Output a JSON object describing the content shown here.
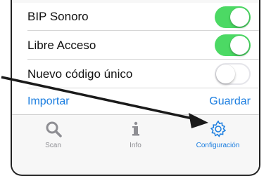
{
  "settings": {
    "rows": [
      {
        "label": "BIP Sonoro",
        "on": true
      },
      {
        "label": "Libre Acceso",
        "on": true
      },
      {
        "label": "Nuevo código único",
        "on": false
      }
    ],
    "import_label": "Importar",
    "save_label": "Guardar"
  },
  "tabbar": {
    "tabs": [
      {
        "label": "Scan",
        "icon": "search-icon",
        "active": false
      },
      {
        "label": "Info",
        "icon": "info-icon",
        "active": false
      },
      {
        "label": "Configuración",
        "icon": "gear-icon",
        "active": true
      }
    ]
  },
  "colors": {
    "accent": "#1a7de0",
    "toggle_on": "#4cd964",
    "arrow": "#1a1a1a"
  }
}
